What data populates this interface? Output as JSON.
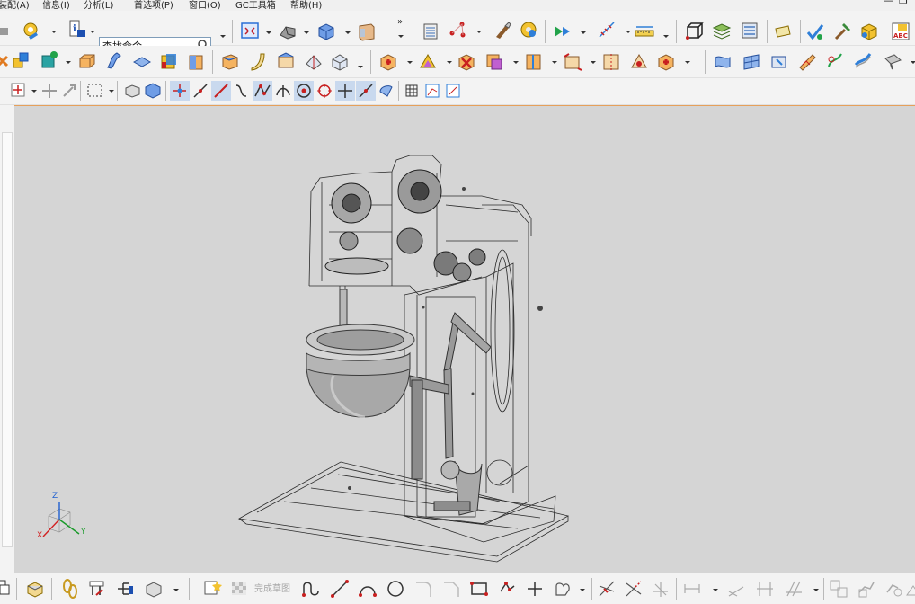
{
  "menubar": {
    "items": [
      "装配(A)",
      "信息(I)",
      "分析(L)",
      "首选项(P)",
      "窗口(O)",
      "GC工具箱",
      "帮助(H)"
    ],
    "window_controls": {
      "minimize": "—",
      "restore": "❐"
    }
  },
  "search": {
    "value": "查找命令",
    "placeholder": "查找命令"
  },
  "sketch_toolbar": {
    "finish_sketch_label": "完成草图"
  },
  "triad": {
    "x_label": "X",
    "y_label": "Y",
    "z_label": "Z"
  },
  "colors": {
    "viewport_background": "#d5d5d5",
    "viewport_border_accent": "#e6a05a",
    "toolbar_background": "#f3f3f3",
    "wire_color": "#2b2b2b",
    "triad_x": "#d22222",
    "triad_y": "#1a9a2a",
    "triad_z": "#1f5fd0"
  },
  "toolbars": {
    "row1": [
      "prev-icon",
      "gear-hand-icon",
      "info-icon",
      "fit-view-icon",
      "shaded-part-icon",
      "cube-icon",
      "door-icon",
      "layers-icon",
      "network-icon",
      "brush-icon",
      "palette-icon",
      "play-icon",
      "scale-icon",
      "ruler-icon",
      "wire-cube-icon",
      "layers2-icon",
      "layers3-icon",
      "note-icon",
      "check-icon",
      "hammer-icon",
      "block-icon",
      "abc-icon"
    ],
    "row2": [
      "cut-icon",
      "blocks-icon",
      "teal-cube-icon",
      "box-icon",
      "sheet-icon",
      "layer-icon",
      "cube-multi-icon",
      "cylinder-icon",
      "plane-icon",
      "curve-icon",
      "fold-icon",
      "blend-icon",
      "chamfer-icon",
      "hex-icon",
      "pyramid-icon",
      "pink-box-icon",
      "gold-box-icon",
      "split-icon",
      "scale-box-icon",
      "mirror-icon",
      "pattern-icon",
      "trim-icon",
      "surface-icon",
      "surface2-icon",
      "pen-icon",
      "wave-icon",
      "sweep-icon",
      "wrench-icon"
    ],
    "row3": [
      "snap-icon",
      "move-icon",
      "select-box-icon",
      "cube-small-icon",
      "cube-blue-icon",
      "point-icon",
      "line-icon",
      "arc-icon",
      "tangent-icon",
      "intersection-icon",
      "center-icon",
      "quadrant-icon",
      "plus-point-icon",
      "midpoint-icon",
      "info2-icon",
      "grid-icon",
      "chart-icon",
      "table-icon"
    ],
    "bottom": [
      "stack-icon",
      "chain-icon",
      "tool-icon",
      "tree-icon",
      "box3-icon",
      "sketch-icon",
      "finish-flag-icon",
      "profile-icon",
      "line-tool-icon",
      "arc-tool-icon",
      "circle-icon",
      "fillet-icon",
      "chamfer-tool-icon",
      "rectangle-icon",
      "polygon-icon",
      "point-tool-icon",
      "offset-icon",
      "trim-tool-icon",
      "extend-icon",
      "corner-icon",
      "mirror-tool-icon",
      "dimension-icon",
      "angle-icon",
      "parallel-icon",
      "perp-icon",
      "constraint-icon",
      "parts-icon",
      "shaft-icon",
      "more-icon"
    ]
  }
}
